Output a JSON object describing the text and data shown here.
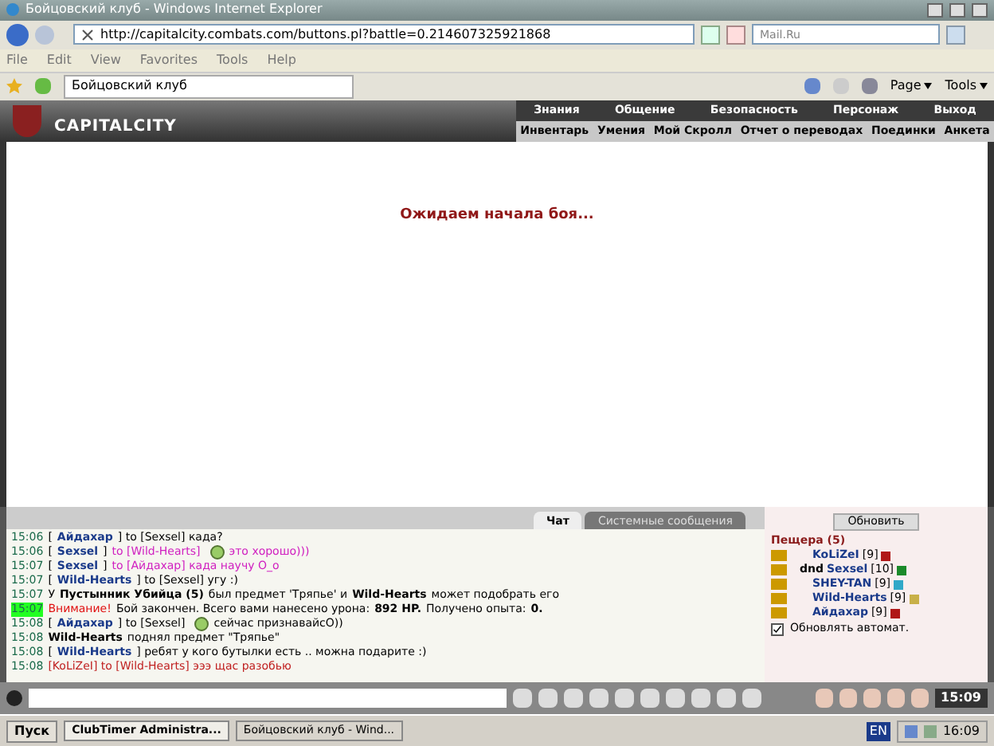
{
  "window": {
    "title": "Бойцовский клуб - Windows Internet Explorer"
  },
  "address_bar": {
    "url": "http://capitalcity.combats.com/buttons.pl?battle=0.214607325921868",
    "search_placeholder": "Mail.Ru"
  },
  "menu": [
    "File",
    "Edit",
    "View",
    "Favorites",
    "Tools",
    "Help"
  ],
  "tab": {
    "title": "Бойцовский клуб"
  },
  "command_bar": [
    "Page",
    "Tools"
  ],
  "game": {
    "logo": "CAPITALCITY",
    "nav_top": [
      "Знания",
      "Общение",
      "Безопасность",
      "Персонаж",
      "Выход"
    ],
    "nav_bottom": [
      "Инвентарь",
      "Умения",
      "Мой Скролл",
      "Отчет о переводах",
      "Поединки",
      "Анкета"
    ],
    "status": "Ожидаем начала боя...",
    "chat_tabs": [
      {
        "label": "Чат",
        "selected": true
      },
      {
        "label": "Системные сообщения",
        "selected": false
      }
    ],
    "messages": [
      {
        "time": "15:06",
        "highlight": false,
        "parts": [
          {
            "kind": "plain",
            "text": "["
          },
          {
            "kind": "nick",
            "text": "Айдахар"
          },
          {
            "kind": "plain",
            "text": "] to [Sexsel] када?"
          }
        ]
      },
      {
        "time": "15:06",
        "highlight": false,
        "parts": [
          {
            "kind": "plain",
            "text": "["
          },
          {
            "kind": "nick",
            "text": "Sexsel"
          },
          {
            "kind": "plain",
            "text": "]"
          },
          {
            "kind": "private",
            "text": "to [Wild-Hearts]"
          },
          {
            "kind": "smiley"
          },
          {
            "kind": "private",
            "text": "это хорошо)))"
          }
        ]
      },
      {
        "time": "15:07",
        "highlight": false,
        "parts": [
          {
            "kind": "plain",
            "text": "["
          },
          {
            "kind": "nick",
            "text": "Sexsel"
          },
          {
            "kind": "plain",
            "text": "]"
          },
          {
            "kind": "private",
            "text": "to [Айдахар] када научу О_о"
          }
        ]
      },
      {
        "time": "15:07",
        "highlight": false,
        "parts": [
          {
            "kind": "plain",
            "text": "["
          },
          {
            "kind": "nick",
            "text": "Wild-Hearts"
          },
          {
            "kind": "plain",
            "text": "] to [Sexsel] угу :)"
          }
        ]
      },
      {
        "time": "15:07",
        "highlight": false,
        "parts": [
          {
            "kind": "plain",
            "text": "У"
          },
          {
            "kind": "bold",
            "text": "Пустынник Убийца (5)"
          },
          {
            "kind": "plain",
            "text": "был предмет 'Тряпье' и"
          },
          {
            "kind": "bold",
            "text": "Wild-Hearts"
          },
          {
            "kind": "plain",
            "text": "может подобрать его"
          }
        ]
      },
      {
        "time": "15:07",
        "highlight": true,
        "parts": [
          {
            "kind": "alert",
            "text": "Внимание!"
          },
          {
            "kind": "plain",
            "text": "Бой закончен. Всего вами нанесено урона:"
          },
          {
            "kind": "bold",
            "text": "892 HP."
          },
          {
            "kind": "plain",
            "text": "Получено опыта:"
          },
          {
            "kind": "bold",
            "text": "0."
          }
        ]
      },
      {
        "time": "15:08",
        "highlight": false,
        "parts": [
          {
            "kind": "plain",
            "text": "["
          },
          {
            "kind": "nick",
            "text": "Айдахар"
          },
          {
            "kind": "plain",
            "text": "] to [Sexsel]"
          },
          {
            "kind": "smiley"
          },
          {
            "kind": "plain",
            "text": "сейчас признавайсО))"
          }
        ]
      },
      {
        "time": "15:08",
        "highlight": false,
        "parts": [
          {
            "kind": "bold",
            "text": "Wild-Hearts"
          },
          {
            "kind": "plain",
            "text": "поднял предмет \"Тряпье\""
          }
        ]
      },
      {
        "time": "15:08",
        "highlight": false,
        "parts": [
          {
            "kind": "plain",
            "text": "["
          },
          {
            "kind": "nick",
            "text": "Wild-Hearts"
          },
          {
            "kind": "plain",
            "text": "] ребят у кого бутылки есть .. можна подарите :)"
          }
        ]
      },
      {
        "time": "15:08",
        "highlight": false,
        "parts": [
          {
            "kind": "red",
            "text": "[KoLiZeI] to [Wild-Hearts] эээ щас разобью"
          }
        ]
      }
    ],
    "refresh_button": "Обновить",
    "location": "Пещера (5)",
    "players": [
      {
        "name": "KoLiZeI",
        "level": "[9]",
        "color": "#b01818"
      },
      {
        "prefix": "dnd",
        "name": "Sexsel",
        "level": "[10]",
        "color": "#1a8a2a"
      },
      {
        "name": "SHEY-TAN",
        "level": "[9]",
        "color": "#30a8c8"
      },
      {
        "name": "Wild-Hearts",
        "level": "[9]",
        "color": "#c8b048"
      },
      {
        "name": "Айдахар",
        "level": "[9]",
        "color": "#b01818"
      }
    ],
    "auto_refresh": {
      "label": "Обновлять автомат.",
      "checked": true
    },
    "clock": "15:09"
  },
  "taskbar": {
    "start": "Пуск",
    "tasks": [
      {
        "label": "ClubTimer Administra...",
        "selected": true
      },
      {
        "label": "Бойцовский клуб - Wind...",
        "selected": false
      }
    ],
    "language": "EN",
    "time": "16:09"
  }
}
